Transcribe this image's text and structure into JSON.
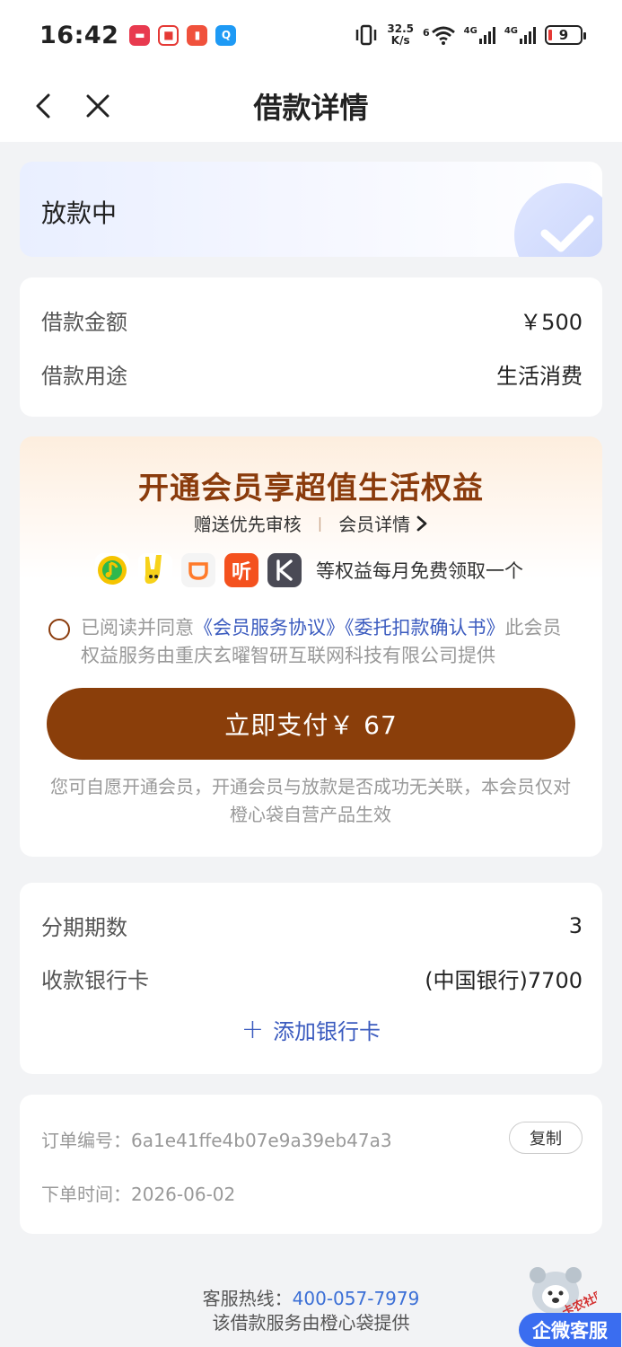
{
  "status_bar": {
    "time": "16:42",
    "net_speed_top": "32.5",
    "net_speed_bottom": "K/s",
    "network_1": "4G",
    "network_2": "4G",
    "battery": "9",
    "wifi_badge": "6"
  },
  "nav": {
    "title": "借款详情"
  },
  "loan_status": {
    "text": "放款中"
  },
  "amount": {
    "amount_label": "借款金额",
    "amount_value": "￥500",
    "purpose_label": "借款用途",
    "purpose_value": "生活消费"
  },
  "membership": {
    "title": "开通会员享超值生活权益",
    "perk": "赠送优先审核",
    "separator": "|",
    "detail_link": "会员详情",
    "brands": [
      {
        "name": "qq-music-icon",
        "color": "#f5c400"
      },
      {
        "name": "mango-tv-icon",
        "color": "#f7d21a"
      },
      {
        "name": "didi-icon",
        "color": "#f4f4f4"
      },
      {
        "name": "ting-icon",
        "color": "#f4511e"
      },
      {
        "name": "keep-icon",
        "color": "#4a4a55"
      }
    ],
    "brands_text": "等权益每月免费领取一个",
    "agree_prefix": "已阅读并同意",
    "agree_link_1": "《会员服务协议》",
    "agree_link_2": "《委托扣款确认书》",
    "agree_suffix": "此会员权益服务由重庆玄曜智研互联网科技有限公司提供",
    "pay_button": "立即支付￥ 67",
    "disclaimer": "您可自愿开通会员，开通会员与放款是否成功无关联，本会员仅对橙心袋自营产品生效",
    "accent_color": "#8a3e0a"
  },
  "loan_details": {
    "term_label": "分期期数",
    "term_value": "3",
    "card_label": "收款银行卡",
    "card_value": "(中国银行)7700",
    "add_card": "添加银行卡"
  },
  "order": {
    "number_label": "订单编号：",
    "number_value": "6a1e41ffe4b07e9a39eb47a3",
    "copy_button": "复制",
    "time_label": "下单时间：",
    "time_value": "2026-06-02"
  },
  "footer": {
    "hotline_label": "客服热线：",
    "hotline_number": "400-057-7979",
    "provider": "该借款服务由橙心袋提供"
  },
  "floating": {
    "service_button": "企微客服",
    "watermark": "卡农社区"
  }
}
